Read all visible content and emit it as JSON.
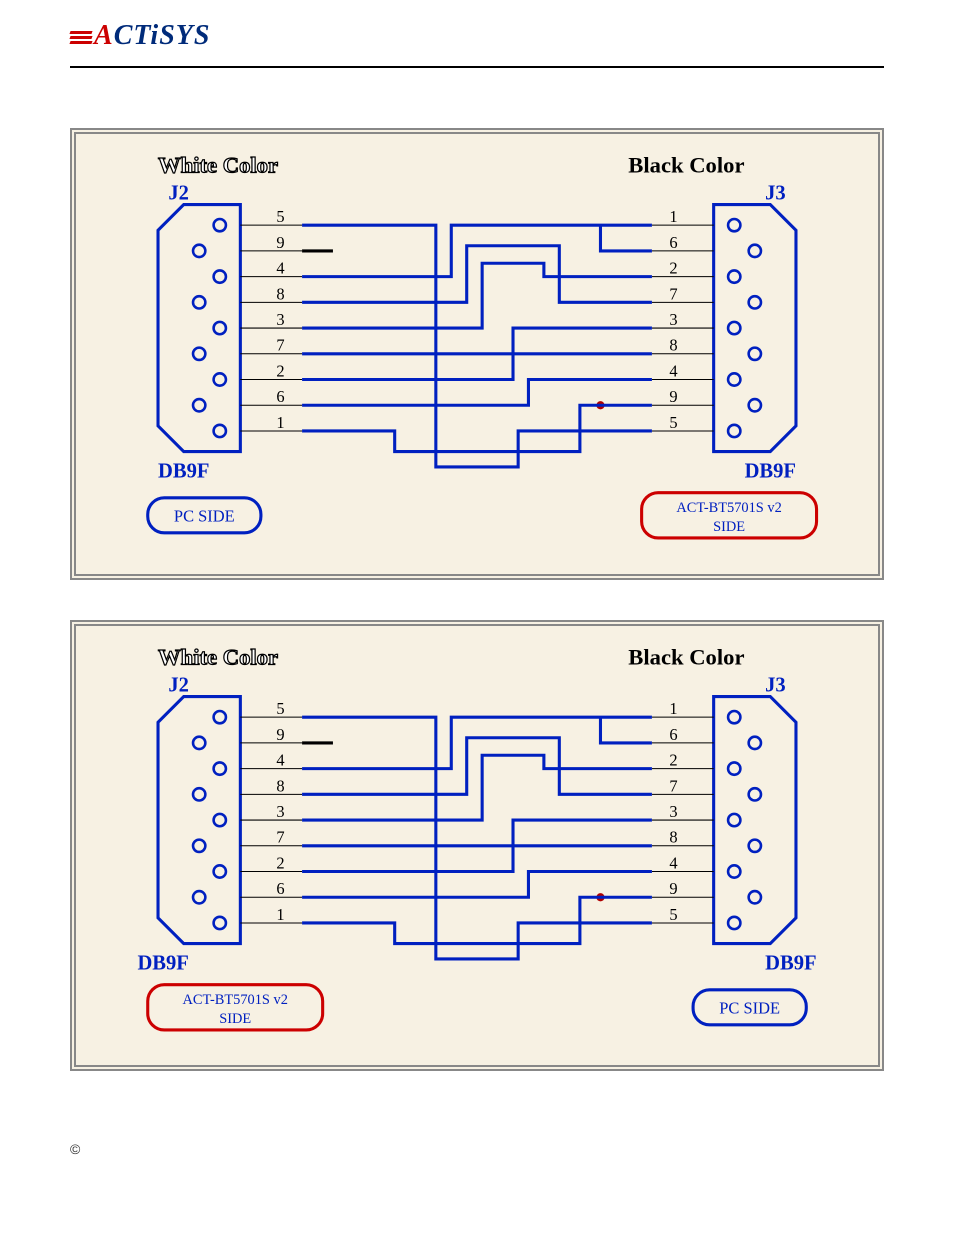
{
  "brand": {
    "name": "ACTiSYS"
  },
  "footer": {
    "copy": "©"
  },
  "diagram_common": {
    "left_color_label": "White Color",
    "right_color_label": "Black Color",
    "left_conn_ref": "J2",
    "right_conn_ref": "J3",
    "left_conn_type": "DB9F",
    "right_conn_type": "DB9F",
    "left_pin_labels": [
      "5",
      "9",
      "4",
      "8",
      "3",
      "7",
      "2",
      "6",
      "1"
    ],
    "right_pin_labels": [
      "1",
      "6",
      "2",
      "7",
      "3",
      "8",
      "4",
      "9",
      "5"
    ],
    "pc_side_label": "PC SIDE",
    "device_side_label": "ACT-BT5701S v2 SIDE",
    "wiring": [
      {
        "from_left": "5",
        "to_right": "5",
        "note": "straight"
      },
      {
        "from_left": "9",
        "to_right": null,
        "note": "not connected"
      },
      {
        "from_left": "4",
        "to_right": "1",
        "note": "cross, also tied to right pin 6 at junction"
      },
      {
        "from_left": "8",
        "to_right": "7",
        "note": "cross"
      },
      {
        "from_left": "3",
        "to_right": "2",
        "note": "cross TX→RX"
      },
      {
        "from_left": "7",
        "to_right": "8",
        "note": "cross"
      },
      {
        "from_left": "2",
        "to_right": "3",
        "note": "cross RX→TX"
      },
      {
        "from_left": "6",
        "to_right": "4",
        "note": "cross, junction dot near right side"
      },
      {
        "from_left": "1",
        "to_right": "9",
        "note": "cross, loops under then up"
      }
    ]
  },
  "diagrams": [
    {
      "left_badge": "pc",
      "right_badge": "device"
    },
    {
      "left_badge": "device",
      "right_badge": "pc"
    }
  ]
}
